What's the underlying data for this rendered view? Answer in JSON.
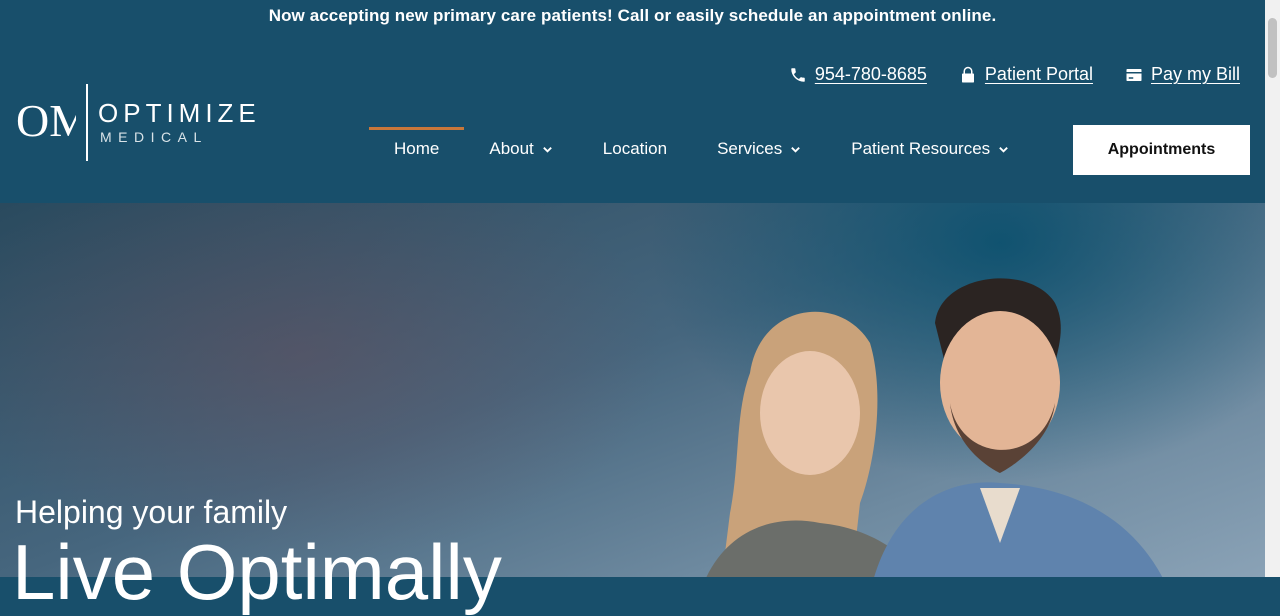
{
  "announcement": "Now accepting new primary care patients! Call or easily schedule an appointment online.",
  "logo": {
    "line1": "OPTIMIZE",
    "line2": "MEDICAL",
    "mark": "OM"
  },
  "utility": {
    "phone": "954-780-8685",
    "portal": "Patient Portal",
    "pay": "Pay my Bill"
  },
  "nav": {
    "items": [
      {
        "label": "Home"
      },
      {
        "label": "About"
      },
      {
        "label": "Location"
      },
      {
        "label": "Services"
      },
      {
        "label": "Patient Resources"
      }
    ],
    "cta": "Appointments"
  },
  "hero": {
    "subtitle": "Helping your family",
    "title": "Live Optimally"
  },
  "colors": {
    "header_bg": "#184f6b",
    "active_accent": "#c9773a",
    "text": "#ffffff"
  },
  "icons": [
    "phone-icon",
    "lock-icon",
    "credit-card-icon",
    "chevron-down-icon"
  ]
}
